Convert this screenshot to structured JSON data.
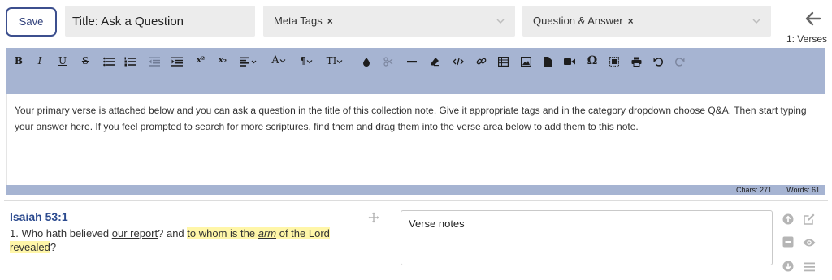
{
  "header": {
    "save_label": "Save",
    "title_value": "Title: Ask a Question",
    "meta_tag": "Meta Tags",
    "category_tag": "Question & Answer",
    "remove_glyph": "×",
    "verses_label": "1: Verses"
  },
  "toolbar": {
    "bold": "B",
    "italic": "I",
    "underline": "U",
    "strike": "S",
    "superscript": "x²",
    "subscript": "x₂",
    "font_color": "A",
    "paragraph": "¶",
    "text_size": "TI",
    "omega": "Ω"
  },
  "editor": {
    "body": "Your primary verse is attached below and you can ask a question in the title of this collection note. Give it appropriate tags and in the category dropdown choose Q&A. Then start typing your answer here. If you feel prompted to search for more scriptures, find them and drag them into the verse area below to add them to this note."
  },
  "status": {
    "chars": "Chars: 271",
    "words": "Words: 61"
  },
  "verse": {
    "reference": "Isaiah 53:1",
    "number_prefix": "1. Who hath believed ",
    "our_report": "our report",
    "mid": "? and ",
    "hl_1": "to whom is the ",
    "arm": "arm",
    "hl_2": " of the Lord revealed",
    "end": "?",
    "notes_value": "Verse notes"
  },
  "colors": {
    "accent": "#3c4f8e",
    "toolbar_bg": "#a6b4d2",
    "reference": "#2b4a8f",
    "highlight": "#fff6a8",
    "field_bg": "#ececec"
  },
  "icons": [
    "chevron-down-icon",
    "arrow-left-icon",
    "move-icon",
    "arrow-up-circle-icon",
    "edit-icon",
    "minus-square-icon",
    "eye-icon",
    "arrow-down-circle-icon",
    "menu-icon"
  ]
}
